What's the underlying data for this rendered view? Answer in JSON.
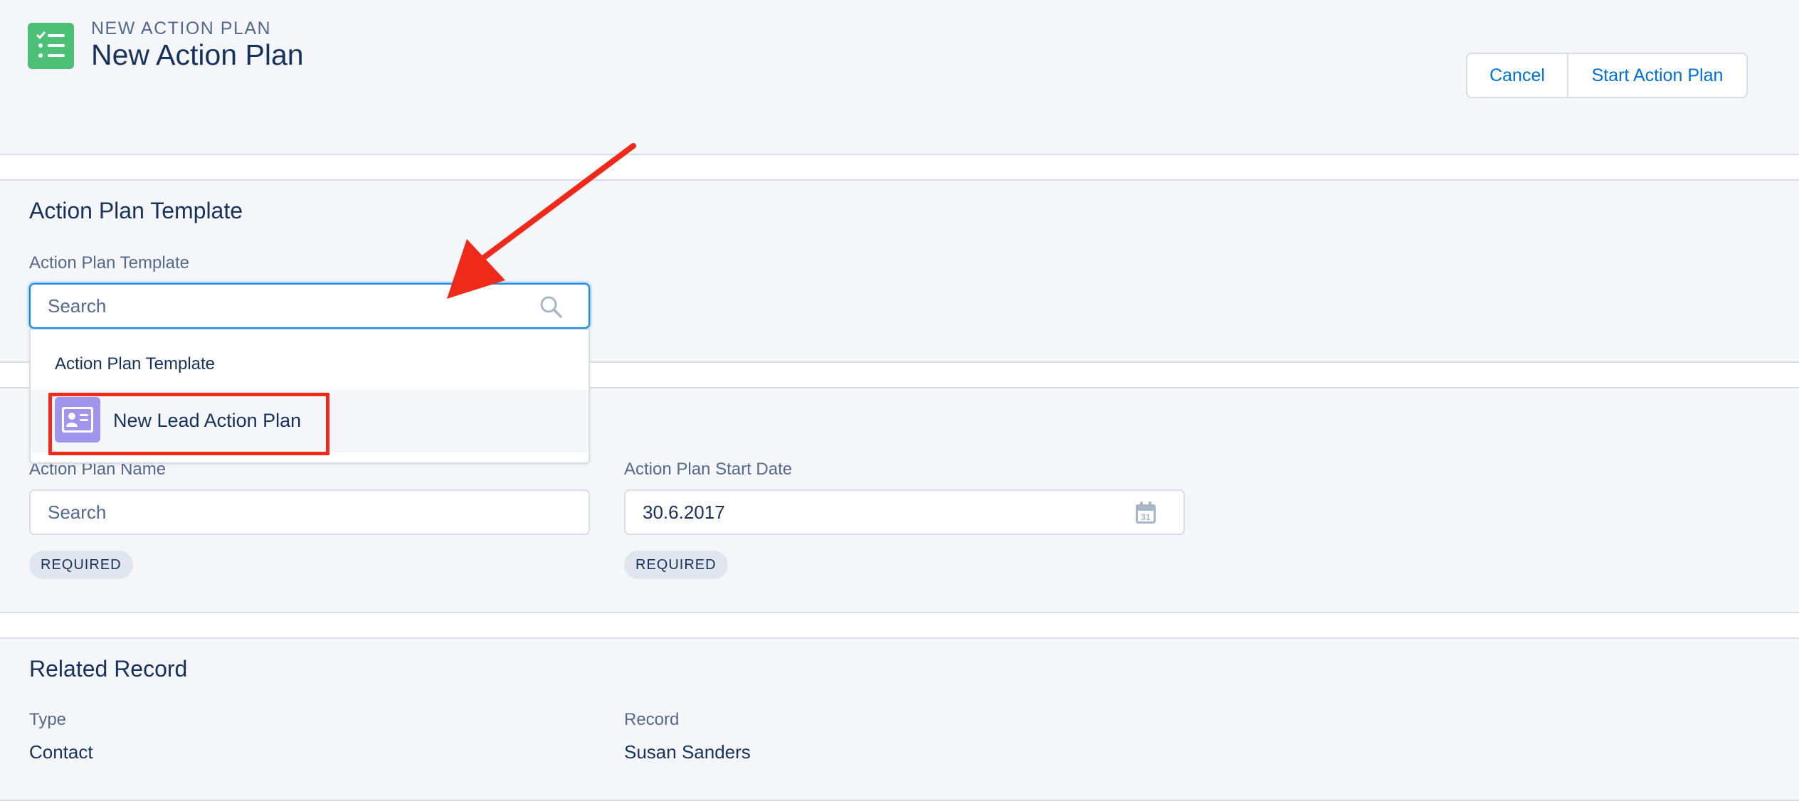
{
  "header": {
    "eyebrow": "NEW ACTION PLAN",
    "title": "New Action Plan",
    "icon": "action-plan-checklist-icon",
    "icon_color": "#4bc076",
    "cancel_label": "Cancel",
    "start_label": "Start Action Plan"
  },
  "template_section": {
    "title": "Action Plan Template",
    "field_label": "Action Plan Template",
    "search_placeholder": "Search",
    "dropdown": {
      "header": "Action Plan Template",
      "options": [
        {
          "label": "New Lead Action Plan",
          "icon": "action-plan-template-icon",
          "icon_color": "#a094ed"
        }
      ]
    }
  },
  "info_section": {
    "name_label": "Action Plan Name",
    "name_placeholder": "Search",
    "name_required": "REQUIRED",
    "start_date_label": "Action Plan Start Date",
    "start_date_value": "30.6.2017",
    "start_date_required": "REQUIRED",
    "calendar_day": "31"
  },
  "related_section": {
    "title": "Related Record",
    "type_label": "Type",
    "type_value": "Contact",
    "record_label": "Record",
    "record_value": "Susan Sanders"
  },
  "colors": {
    "accent": "#0070d2",
    "focus_border": "#1589ee",
    "annotation_red": "#f02a1b"
  }
}
